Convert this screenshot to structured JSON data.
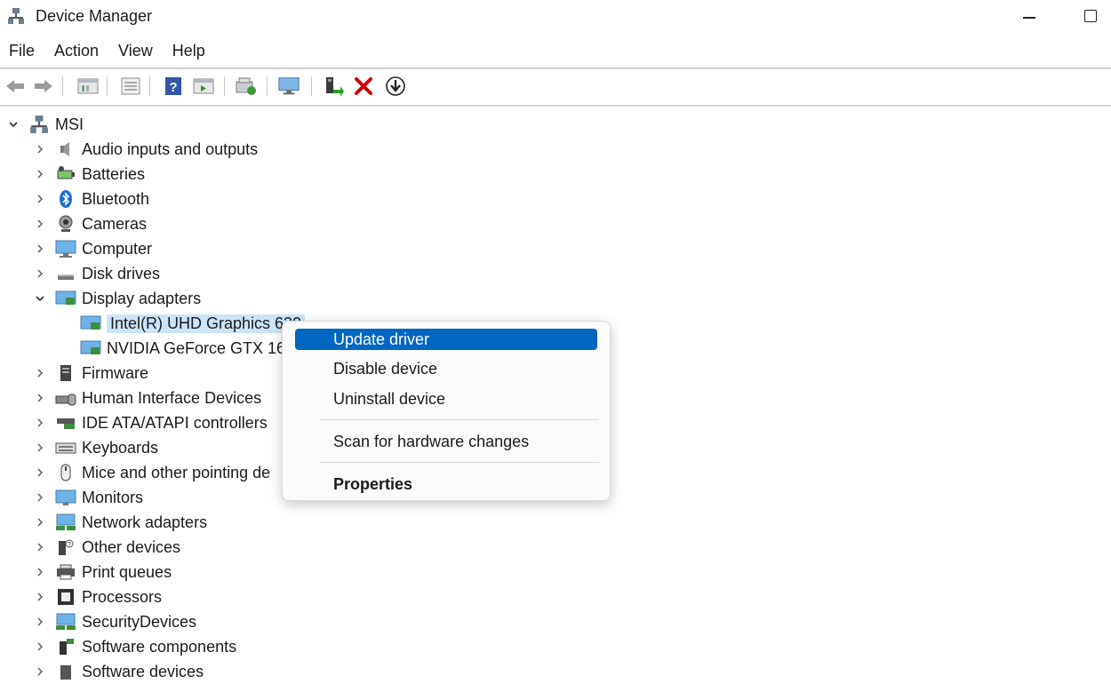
{
  "window": {
    "title": "Device Manager"
  },
  "menu": [
    "File",
    "Action",
    "View",
    "Help"
  ],
  "toolbar": {
    "buttons": [
      "back-icon",
      "forward-icon",
      "properties-grid-icon",
      "list-view-icon",
      "help-icon",
      "run-icon",
      "scan-icon",
      "monitor-icon",
      "add-driver-icon",
      "uninstall-icon",
      "download-icon"
    ]
  },
  "tree": {
    "root": "MSI",
    "categories": [
      {
        "label": "Audio inputs and outputs",
        "icon": "speaker-icon"
      },
      {
        "label": "Batteries",
        "icon": "battery-icon"
      },
      {
        "label": "Bluetooth",
        "icon": "bluetooth-icon"
      },
      {
        "label": "Cameras",
        "icon": "camera-icon"
      },
      {
        "label": "Computer",
        "icon": "computer-icon"
      },
      {
        "label": "Disk drives",
        "icon": "disk-icon"
      },
      {
        "label": "Display adapters",
        "icon": "display-adapter-icon",
        "expanded": true,
        "children": [
          "Intel(R) UHD Graphics 630",
          "NVIDIA GeForce GTX 16"
        ]
      },
      {
        "label": "Firmware",
        "icon": "firmware-icon"
      },
      {
        "label": "Human Interface Devices",
        "icon": "hid-icon"
      },
      {
        "label": "IDE ATA/ATAPI controllers",
        "icon": "ide-icon"
      },
      {
        "label": "Keyboards",
        "icon": "keyboard-icon"
      },
      {
        "label": "Mice and other pointing de",
        "icon": "mouse-icon"
      },
      {
        "label": "Monitors",
        "icon": "monitor-icon"
      },
      {
        "label": "Network adapters",
        "icon": "network-icon"
      },
      {
        "label": "Other devices",
        "icon": "other-device-icon"
      },
      {
        "label": "Print queues",
        "icon": "printer-icon"
      },
      {
        "label": "Processors",
        "icon": "processor-icon"
      },
      {
        "label": "SecurityDevices",
        "icon": "security-icon"
      },
      {
        "label": "Software components",
        "icon": "software-component-icon"
      },
      {
        "label": "Software devices",
        "icon": "software-device-icon"
      }
    ]
  },
  "context_menu": {
    "items": [
      {
        "label": "Update driver",
        "highlighted": true
      },
      {
        "label": "Disable device"
      },
      {
        "label": "Uninstall device"
      },
      {
        "label": "Scan for hardware changes"
      },
      {
        "label": "Properties",
        "bold": true
      }
    ]
  },
  "colors": {
    "highlight": "#0067c0",
    "selection": "#cce4f7",
    "delete_x": "#d00000"
  }
}
